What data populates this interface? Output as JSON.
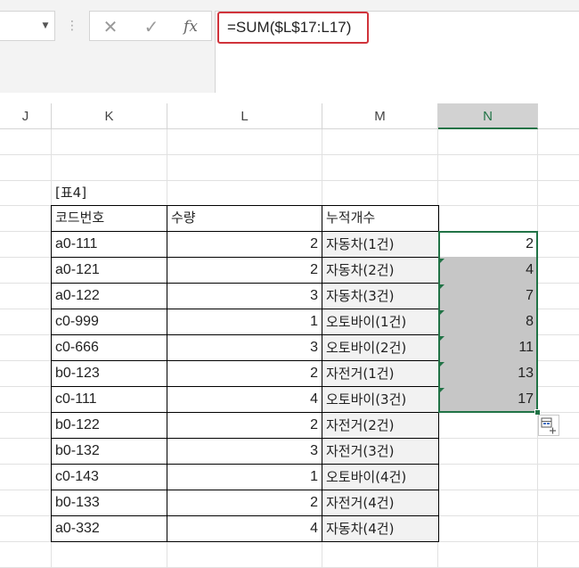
{
  "formula_bar": {
    "name_box_value": "",
    "formula": "=SUM($L$17:L17)",
    "cancel_glyph": "✕",
    "enter_glyph": "✓",
    "fx_glyph": "fx",
    "dots_glyph": "⋮",
    "dropdown_glyph": "▼"
  },
  "columns": [
    "J",
    "K",
    "L",
    "M",
    "N"
  ],
  "table": {
    "caption": "[표4]",
    "headers": [
      "코드번호",
      "수량",
      "누적개수"
    ],
    "rows": [
      {
        "code": "a0-111",
        "qty": "2",
        "label": "자동차(1건)",
        "cum": "2"
      },
      {
        "code": "a0-121",
        "qty": "2",
        "label": "자동차(2건)",
        "cum": "4"
      },
      {
        "code": "a0-122",
        "qty": "3",
        "label": "자동차(3건)",
        "cum": "7"
      },
      {
        "code": "c0-999",
        "qty": "1",
        "label": "오토바이(1건)",
        "cum": "8"
      },
      {
        "code": "c0-666",
        "qty": "3",
        "label": "오토바이(2건)",
        "cum": "11"
      },
      {
        "code": "b0-123",
        "qty": "2",
        "label": "자전거(1건)",
        "cum": "13"
      },
      {
        "code": "c0-111",
        "qty": "4",
        "label": "오토바이(3건)",
        "cum": "17"
      },
      {
        "code": "b0-122",
        "qty": "2",
        "label": "자전거(2건)",
        "cum": ""
      },
      {
        "code": "b0-132",
        "qty": "3",
        "label": "자전거(3건)",
        "cum": ""
      },
      {
        "code": "c0-143",
        "qty": "1",
        "label": "오토바이(4건)",
        "cum": ""
      },
      {
        "code": "b0-133",
        "qty": "2",
        "label": "자전거(4건)",
        "cum": ""
      },
      {
        "code": "a0-332",
        "qty": "4",
        "label": "자동차(4건)",
        "cum": ""
      }
    ]
  },
  "colors": {
    "selection": "#217346",
    "formula_highlight": "#d0333b",
    "selected_cell_fill": "#c6c6c6"
  },
  "quick_analysis_icon": "quick-analysis-icon"
}
